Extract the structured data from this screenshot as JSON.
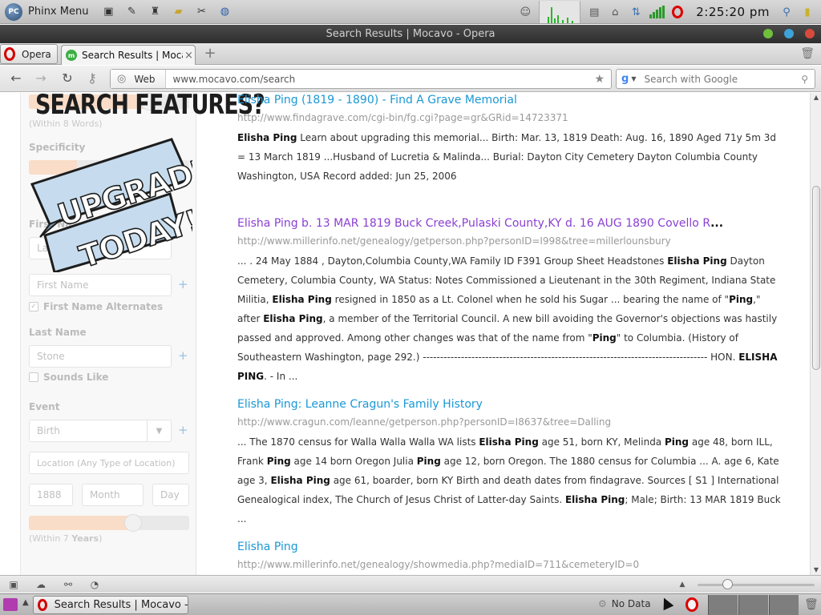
{
  "top_panel": {
    "menu_label": "Phinx Menu",
    "menu_logo": "PC",
    "clock": "2:25:20 pm",
    "launchers": [
      "terminal-icon",
      "text-editor-icon",
      "paint-icon",
      "folder-icon",
      "settings-icon",
      "browser-icon"
    ],
    "tray": [
      "user-icon",
      "cpu-graph",
      "clipboard-icon",
      "network-icon",
      "network-status-icon",
      "signal-icon",
      "opera-icon",
      "clock",
      "user-switch-icon",
      "battery-icon"
    ]
  },
  "window": {
    "title": "Search Results | Mocavo - Opera"
  },
  "tabs": {
    "opera_menu": "Opera",
    "active_tab_title": "Search Results | Moca...",
    "favicon_letter": "m",
    "close_glyph": "×",
    "new_tab_glyph": "+"
  },
  "address_bar": {
    "web_label": "Web",
    "url": "www.mocavo.com/search",
    "search_placeholder": "Search with Google",
    "search_engine_glyph": "g"
  },
  "sidebar": {
    "promo_title": "SEARCH FEATURES?",
    "promo_line1": "UPGRADE",
    "promo_line2": "TODAY!",
    "within_words": "(Within 8 Words)",
    "specificity_label": "Specificity",
    "first_name_label": "First Na",
    "first_name_ph": "La",
    "first_name_alt_ph": "First Name",
    "first_name_alternates": "First Name Alternates",
    "last_name_label": "Last Name",
    "last_name_value": "Stone",
    "sounds_like": "Sounds Like",
    "event_label": "Event",
    "event_value": "Birth",
    "location_ph": "Location (Any Type of Location)",
    "year_value": "1888",
    "month_ph": "Month",
    "day_ph": "Day",
    "within_years_prefix": "(Within 7 ",
    "within_years_bold": "Years",
    "within_years_suffix": ")",
    "word_slider_level": 0.75,
    "year_slider_level": 0.65
  },
  "results": [
    {
      "title": "Elisha Ping (1819 - 1890) - Find A Grave Memorial",
      "url": "http://www.findagrave.com/cgi-bin/fg.cgi?page=gr&GRid=14723371",
      "snippet_html": "<b>Elisha Ping</b> Learn about upgrading this memorial... Birth: Mar. 13, 1819 Death: Aug. 16, 1890 Aged 71y 5m 3d = 13 March 1819 ...Husband of Lucretia &amp; Malinda... Burial: Dayton City Cemetery Dayton Columbia County Washington, USA Record added: Jun 25, 2006",
      "visited": false
    },
    {
      "title": "Elisha Ping b. 13 MAR 1819 Buck Creek,Pulaski County,KY d. 16 AUG 1890 Covello R",
      "title_ellipsis": "...",
      "url": "http://www.millerinfo.net/genealogy/getperson.php?personID=I998&tree=millerlounsbury",
      "snippet_html": "... . 24 May 1884 , Dayton,Columbia County,WA Family ID F391 Group Sheet Headstones <b>Elisha Ping</b> Dayton Cemetery, Columbia County, WA Status: Notes Commissioned a Lieutenant in the 30th Regiment, Indiana State Militia, <b>Elisha Ping</b> resigned in 1850 as a Lt. Colonel when he sold his Sugar ... bearing the name of \"<b>Ping</b>,\" after <b>Elisha Ping</b>, a member of the Territorial Council. A new bill avoiding the Governor's objections was hastily passed and approved. Among other changes was that of the name from \"<b>Ping</b>\" to Columbia. (History of Southeastern Washington, page 292.) ---------------------------------------------------------------------------------- HON. <b>ELISHA PING</b>. - In ...",
      "visited": true
    },
    {
      "title": "Elisha Ping: Leanne Cragun's Family History",
      "url": "http://www.cragun.com/leanne/getperson.php?personID=I8637&tree=Dalling",
      "snippet_html": "... The 1870 census for Walla Walla Walla WA lists <b>Elisha Ping</b> age 51, born KY, Melinda <b>Ping</b> age 48, born ILL, Frank <b>Ping</b> age 14 born Oregon Julia <b>Ping</b> age 12, born Oregon. The 1880 census for Columbia ... A. age 6, Kate age 3, <b>Elisha Ping</b> age 61, boarder, born KY Birth and death dates from findagrave. Sources [ S1 ] International Genealogical index, The Church of Jesus Christ of Latter-day Saints. <b>Elisha Ping</b>; Male; Birth: 13 MAR 1819 Buck ...",
      "visited": false
    },
    {
      "title": "Elisha Ping",
      "url": "http://www.millerinfo.net/genealogy/showmedia.php?mediaID=711&cemeteryID=0",
      "snippet_html": "",
      "visited": false
    }
  ],
  "statusbar": {
    "icons": [
      "panel-toggle-icon",
      "cloud-icon",
      "share-icon",
      "speed-dial-icon"
    ],
    "zoom_level": 0.25
  },
  "taskbar": {
    "task_label": "Search Results | Mocavo -...",
    "no_data": "No Data"
  },
  "colors": {
    "link": "#1a98d5",
    "visited_link": "#8a3fd1",
    "url_gray": "#999999",
    "opera_red": "#d30000"
  }
}
